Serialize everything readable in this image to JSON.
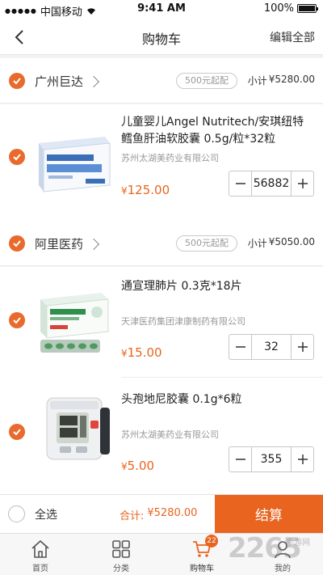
{
  "status_bar": {
    "carrier": "中国移动",
    "time": "9:41 AM",
    "battery": "100%"
  },
  "nav": {
    "title": "购物车",
    "edit_label": "编辑全部",
    "back_icon": "chevron-left-icon"
  },
  "stores": [
    {
      "name": "广州巨达",
      "min_order": "500元起配",
      "subtotal_label": "小计",
      "subtotal_value": "¥5280.00",
      "items": [
        {
          "name": "儿童婴儿Angel Nutritech/安琪纽特鳕鱼肝油软胶囊 0.5g/粒*32粒",
          "maker": "苏州太湖美药业有限公司",
          "price_symbol": "¥",
          "price": "125.00",
          "quantity": "56882"
        }
      ]
    },
    {
      "name": "阿里医药",
      "min_order": "500元起配",
      "subtotal_label": "小计",
      "subtotal_value": "¥5050.00",
      "items": [
        {
          "name": "通宣理肺片 0.3克*18片",
          "maker": "天津医药集团津康制药有限公司",
          "price_symbol": "¥",
          "price": "15.00",
          "quantity": "32"
        },
        {
          "name": "头孢地尼胶囊 0.1g*6粒",
          "maker": "苏州太湖美药业有限公司",
          "price_symbol": "¥",
          "price": "5.00",
          "quantity": "355"
        }
      ]
    }
  ],
  "bottom": {
    "select_all": "全选",
    "total_label": "合计:",
    "total_value": "¥5280.00",
    "checkout": "结算"
  },
  "tabs": [
    {
      "label": "首页",
      "icon": "home-icon"
    },
    {
      "label": "分类",
      "icon": "category-grid-icon"
    },
    {
      "label": "购物车",
      "icon": "cart-icon",
      "badge": "22"
    },
    {
      "label": "我的",
      "icon": "user-icon"
    }
  ],
  "watermark": {
    "text": "2265",
    "sub": "手游网"
  },
  "colors": {
    "accent": "#e8641f",
    "check": "#e86a2c"
  }
}
